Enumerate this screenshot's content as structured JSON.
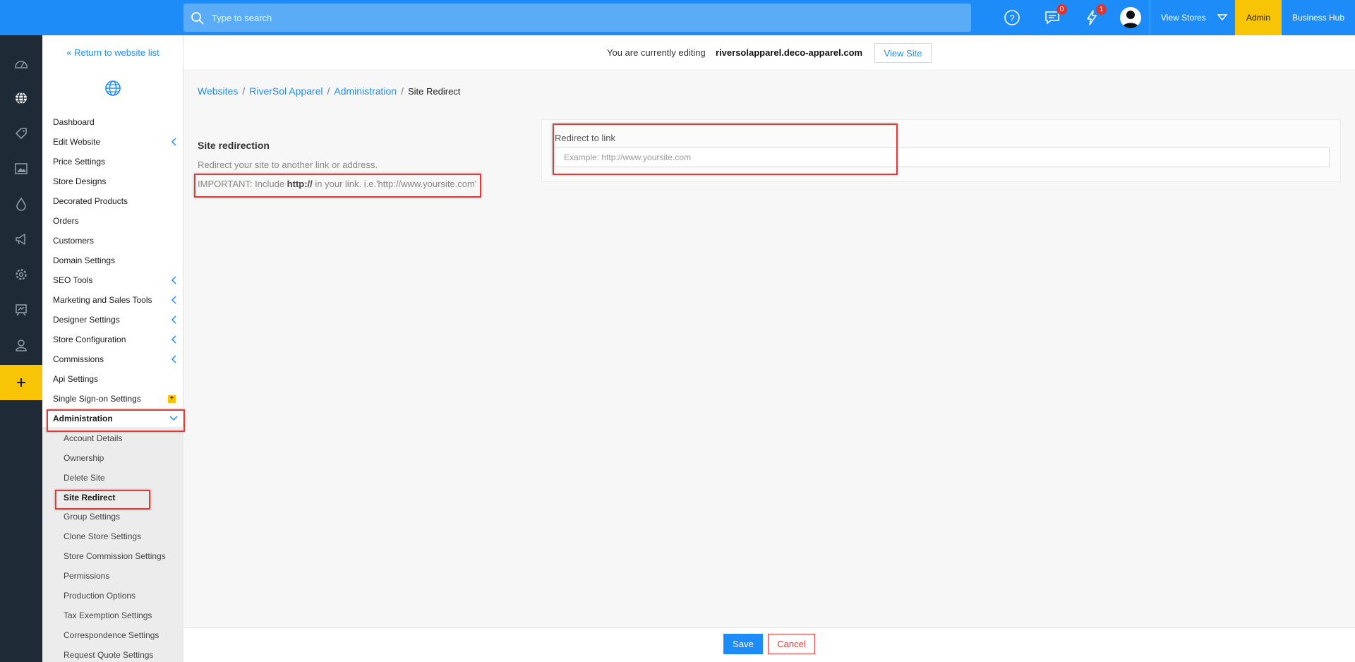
{
  "topbar": {
    "search_placeholder": "Type to search",
    "messages_count": "0",
    "notifications_count": "1",
    "view_stores_label": "View Stores",
    "admin_label": "Admin",
    "business_hub_label": "Business Hub",
    "icons": [
      "search-icon",
      "help-icon",
      "messages-icon",
      "notifications-icon",
      "user-avatar-icon",
      "chevron-down-icon"
    ]
  },
  "rail": {
    "icons": [
      "dashboard-icon",
      "globe-icon",
      "tag-icon",
      "image-icon",
      "drop-icon",
      "megaphone-icon",
      "gear-icon",
      "storefront-icon",
      "user-icon",
      "plus-icon"
    ],
    "accent": "#f8c506"
  },
  "sidebar": {
    "return_link": "« Return to website list",
    "items": [
      {
        "label": "Dashboard"
      },
      {
        "label": "Edit Website"
      },
      {
        "label": "Price Settings"
      },
      {
        "label": "Store Designs"
      },
      {
        "label": "Decorated Products"
      },
      {
        "label": "Orders"
      },
      {
        "label": "Customers"
      },
      {
        "label": "Domain Settings"
      },
      {
        "label": "SEO Tools"
      },
      {
        "label": "Marketing and Sales Tools"
      },
      {
        "label": "Designer Settings"
      },
      {
        "label": "Store Configuration"
      },
      {
        "label": "Commissions"
      },
      {
        "label": "Api Settings"
      },
      {
        "label": "Single Sign-on Settings"
      },
      {
        "label": "Administration"
      }
    ],
    "sub_items": [
      {
        "label": "Account Details"
      },
      {
        "label": "Ownership"
      },
      {
        "label": "Delete Site"
      },
      {
        "label": "Site Redirect"
      },
      {
        "label": "Group Settings"
      },
      {
        "label": "Clone Store Settings"
      },
      {
        "label": "Store Commission Settings"
      },
      {
        "label": "Permissions"
      },
      {
        "label": "Production Options"
      },
      {
        "label": "Tax Exemption Settings"
      },
      {
        "label": "Correspondence Settings"
      },
      {
        "label": "Request Quote Settings"
      }
    ]
  },
  "editing_bar": {
    "text": "You are currently editing",
    "domain": "riversolapparel.deco-apparel.com",
    "view_site_label": "View Site"
  },
  "breadcrumb": {
    "websites": "Websites",
    "store": "RiverSol Apparel",
    "section": "Administration",
    "current": "Site Redirect",
    "separator": "/"
  },
  "section": {
    "title": "Site redirection",
    "description": "Redirect your site to another link or address.",
    "important_prefix": "IMPORTANT: Include ",
    "important_bold": "http://",
    "important_suffix": " in your link. i.e.'http://www.yoursite.com'"
  },
  "form": {
    "redirect_label": "Redirect to link",
    "redirect_value": "",
    "redirect_placeholder": "Example: http://www.yoursite.com"
  },
  "footer": {
    "save_label": "Save",
    "cancel_label": "Cancel"
  },
  "colors": {
    "primary": "#1d8cf8",
    "accent": "#f8c506",
    "danger": "#e03a3a",
    "rail": "#1e2a35"
  }
}
